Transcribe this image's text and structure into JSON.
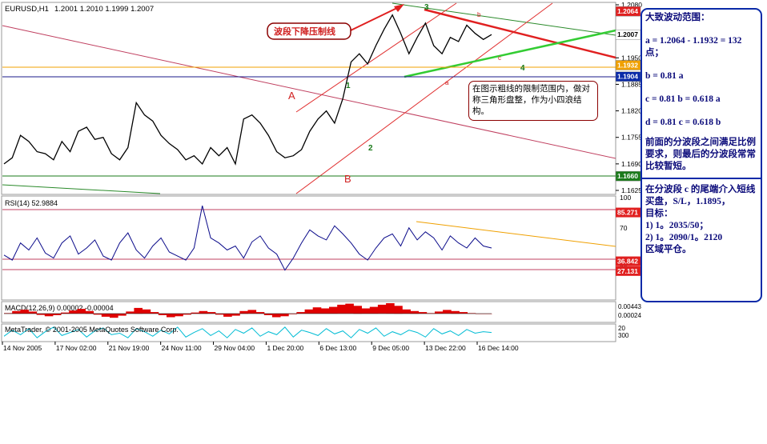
{
  "header": {
    "symbol": "EURUSD,H1",
    "ohlc": "1.2001 1.2010 1.1999 1.2007"
  },
  "colors": {
    "price_line": "#000000",
    "rsi_line": "#0a0a8a",
    "macd_hist": "#e00000",
    "stoch_line": "#00bcd4",
    "resistance_red": "#e02020",
    "triangle_green": "#33cc33",
    "channel_red": "#e03030",
    "level_box_red": "#e02020",
    "level_box_blue": "#0a2aa8",
    "level_box_green": "#1a7a1a",
    "level_box_orange": "#f0a000",
    "panel_border": "#0a2aa8"
  },
  "chart_data": [
    {
      "type": "line",
      "panel": "price",
      "title": "EURUSD,H1",
      "x": [
        "14 Nov 2005",
        "17 Nov 02:00",
        "21 Nov 19:00",
        "24 Nov 11:00",
        "29 Nov 04:00",
        "1 Dec 20:00",
        "6 Dec 13:00",
        "9 Dec 05:00",
        "13 Dec 22:00",
        "16 Dec 14:00"
      ],
      "series": [
        {
          "values": [
            1.169,
            1.1705,
            1.176,
            1.1745,
            1.172,
            1.1715,
            1.17,
            1.1745,
            1.172,
            1.177,
            1.178,
            1.175,
            1.1755,
            1.1715,
            1.17,
            1.173,
            1.184,
            1.181,
            1.1795,
            1.176,
            1.174,
            1.1725,
            1.17,
            1.171,
            1.169,
            1.173,
            1.171,
            1.173,
            1.169,
            1.18,
            1.181,
            1.179,
            1.176,
            1.172,
            1.1705,
            1.171,
            1.1725,
            1.177,
            1.18,
            1.182,
            1.179,
            1.185,
            1.194,
            1.196,
            1.1935,
            1.198,
            1.202,
            1.2055,
            1.201,
            1.196,
            1.2,
            1.2035,
            1.198,
            1.196,
            1.2,
            1.199,
            1.203,
            1.201,
            1.1995,
            1.2007
          ]
        }
      ],
      "ylim": [
        1.1625,
        1.208
      ],
      "y_ticks": [
        1.208,
        1.195,
        1.1885,
        1.182,
        1.1755,
        1.169,
        1.1625
      ],
      "level_labels": [
        {
          "text": "1.2064",
          "value": 1.2064,
          "color": "#e02020"
        },
        {
          "text": "1.2007",
          "value": 1.2007,
          "color": "#000000"
        },
        {
          "text": "1.1932",
          "value": 1.1932,
          "color": "#f0a000"
        },
        {
          "text": "1.1904",
          "value": 1.1904,
          "color": "#0a2aa8"
        },
        {
          "text": "1.1660",
          "value": 1.166,
          "color": "#1a7a1a"
        }
      ],
      "wave_labels": [
        "A",
        "B",
        "1",
        "2",
        "3",
        "4",
        "a",
        "b",
        "c"
      ]
    },
    {
      "type": "line",
      "panel": "rsi",
      "title": "RSI(14) 52.9884",
      "series": [
        {
          "values": [
            43,
            38,
            55,
            48,
            60,
            45,
            40,
            55,
            62,
            44,
            50,
            58,
            42,
            38,
            55,
            65,
            48,
            40,
            52,
            60,
            46,
            42,
            38,
            50,
            92,
            60,
            55,
            48,
            52,
            40,
            56,
            62,
            50,
            44,
            28,
            40,
            55,
            68,
            62,
            58,
            72,
            64,
            55,
            44,
            38,
            50,
            60,
            64,
            52,
            70,
            58,
            66,
            60,
            48,
            62,
            55,
            50,
            60,
            52,
            50
          ]
        }
      ],
      "ylim": [
        0,
        100
      ],
      "y_ticks": [
        100,
        70,
        30
      ],
      "level_labels": [
        {
          "text": "85.271",
          "value": 85.271,
          "color": "#e02020"
        },
        {
          "text": "36.842",
          "value": 36.842,
          "color": "#e02020"
        },
        {
          "text": "27.131",
          "value": 27.131,
          "color": "#e02020"
        }
      ]
    },
    {
      "type": "bar",
      "panel": "macd",
      "title": "MACD(12,26,9) 0.00002 -0.00004",
      "series": [
        {
          "values": [
            0.0002,
            0.001,
            0.0015,
            0.0008,
            -0.0005,
            -0.001,
            -0.0006,
            0.0004,
            0.0012,
            0.0018,
            0.001,
            -0.0004,
            -0.0012,
            -0.0016,
            -0.0008,
            0.0008,
            0.0022,
            0.0016,
            0.0006,
            -0.0006,
            -0.0014,
            -0.001,
            -0.0004,
            0.0004,
            0.001,
            0.0006,
            -0.0004,
            -0.0012,
            -0.0008,
            0.001,
            0.0014,
            0.0006,
            -0.0006,
            -0.0014,
            -0.001,
            -0.0002,
            0.0006,
            0.0016,
            0.0024,
            0.002,
            0.0026,
            0.0034,
            0.0038,
            0.003,
            0.002,
            0.0026,
            0.0034,
            0.004,
            0.003,
            0.0016,
            0.001,
            0.0006,
            0.0002,
            0.0008,
            0.0014,
            0.001,
            0.0006,
            0.0002,
            0.0,
            0.0
          ]
        }
      ],
      "y_ticks": [
        0.00443,
        0.00024
      ]
    },
    {
      "type": "line",
      "panel": "stochastic",
      "title": "MetaTrader, © 2001-2005 MetaQuotes Software Corp.",
      "series": [
        {
          "values": [
            30,
            70,
            40,
            80,
            20,
            60,
            90,
            35,
            55,
            75,
            25,
            65,
            85,
            40,
            50,
            20,
            80,
            60,
            30,
            70,
            45,
            90,
            25,
            55,
            80,
            35,
            65,
            20,
            75,
            50,
            85,
            30,
            60,
            40,
            90,
            25,
            70,
            55,
            35,
            80,
            45,
            65,
            20,
            75,
            50,
            85,
            30,
            60,
            40,
            70,
            55,
            25,
            80,
            45,
            65,
            35,
            75,
            50,
            60,
            55
          ]
        }
      ],
      "y_ticks": [
        20,
        300
      ]
    }
  ],
  "annotations": {
    "pressure_line_label": "波段下降压制线",
    "callout_text": "在图示粗线的限制范围内，做对称三角形盘整，作为小四浪结构。"
  },
  "notes_panel": {
    "section1": [
      "大致波动范围：",
      "a = 1.2064 - 1.1932 = 132点；",
      "b = 0.81 a",
      "c = 0.81 b = 0.618 a",
      "d = 0.81 c = 0.618 b",
      "前面的分波段之间满足比例要求，则最后的分波段常常比较暂短。"
    ],
    "section2": [
      "在分波段 c 的尾端介入短线买盘，S/L，1.1895，",
      "目标：",
      "1) 1。2035/50；",
      "2) 1。2090/1。2120",
      "区域平仓。"
    ]
  }
}
